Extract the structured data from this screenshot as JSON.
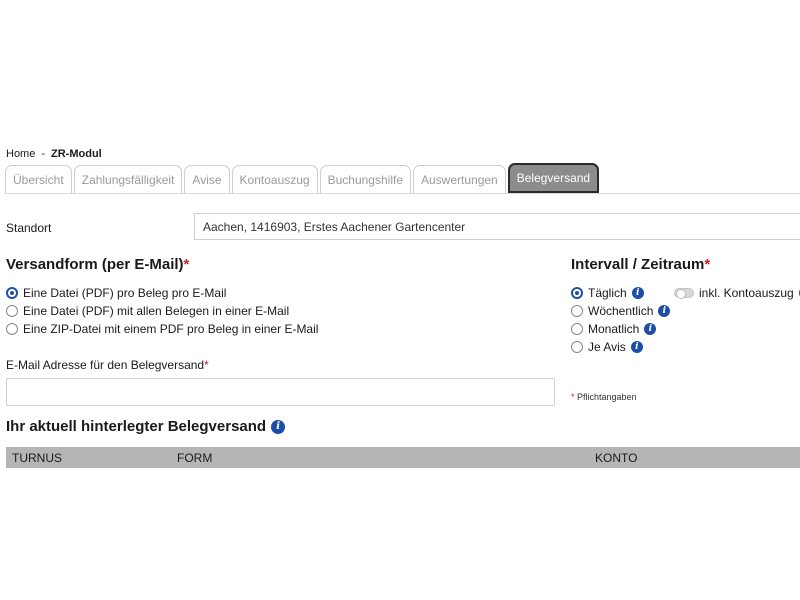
{
  "breadcrumb": {
    "home": "Home",
    "separator": "-",
    "current": "ZR-Modul"
  },
  "tabs": [
    {
      "label": "Übersicht",
      "active": false
    },
    {
      "label": "Zahlungsfälligkeit",
      "active": false
    },
    {
      "label": "Avise",
      "active": false
    },
    {
      "label": "Kontoauszug",
      "active": false
    },
    {
      "label": "Buchungshilfe",
      "active": false
    },
    {
      "label": "Auswertungen",
      "active": false
    },
    {
      "label": "Belegversand",
      "active": true
    }
  ],
  "standort": {
    "label": "Standort",
    "value": "Aachen, 1416903, Erstes Aachener Gartencenter"
  },
  "versandform": {
    "title": "Versandform (per E-Mail)",
    "required_mark": "*",
    "options": [
      {
        "label": "Eine Datei (PDF) pro Beleg pro E-Mail",
        "checked": true
      },
      {
        "label": "Eine Datei (PDF) mit allen Belegen in einer E-Mail",
        "checked": false
      },
      {
        "label": "Eine ZIP-Datei mit einem PDF pro Beleg in einer E-Mail",
        "checked": false
      }
    ]
  },
  "intervall": {
    "title": "Intervall / Zeitraum",
    "required_mark": "*",
    "options": [
      {
        "label": "Täglich",
        "checked": true
      },
      {
        "label": "Wöchentlich",
        "checked": false
      },
      {
        "label": "Monatlich",
        "checked": false
      },
      {
        "label": "Je Avis",
        "checked": false
      }
    ],
    "toggle_label": "inkl. Kontoauszug",
    "toggle_on": false
  },
  "email": {
    "label": "E-Mail Adresse für den Belegversand",
    "required_mark": "*",
    "value": "",
    "placeholder": ""
  },
  "pflicht": {
    "mark": "*",
    "text": "Pflichtangaben"
  },
  "hinterlegt": {
    "title": "Ihr aktuell hinterlegter Belegversand",
    "columns": [
      "TURNUS",
      "FORM",
      "KONTO"
    ]
  },
  "icons": {
    "info": "info-icon",
    "info_glyph": "i"
  },
  "colors": {
    "accent": "#1d4da6",
    "required": "#d0202f",
    "tab_active_bg": "#8c8c8c",
    "table_head_bg": "#b5b5b5"
  }
}
